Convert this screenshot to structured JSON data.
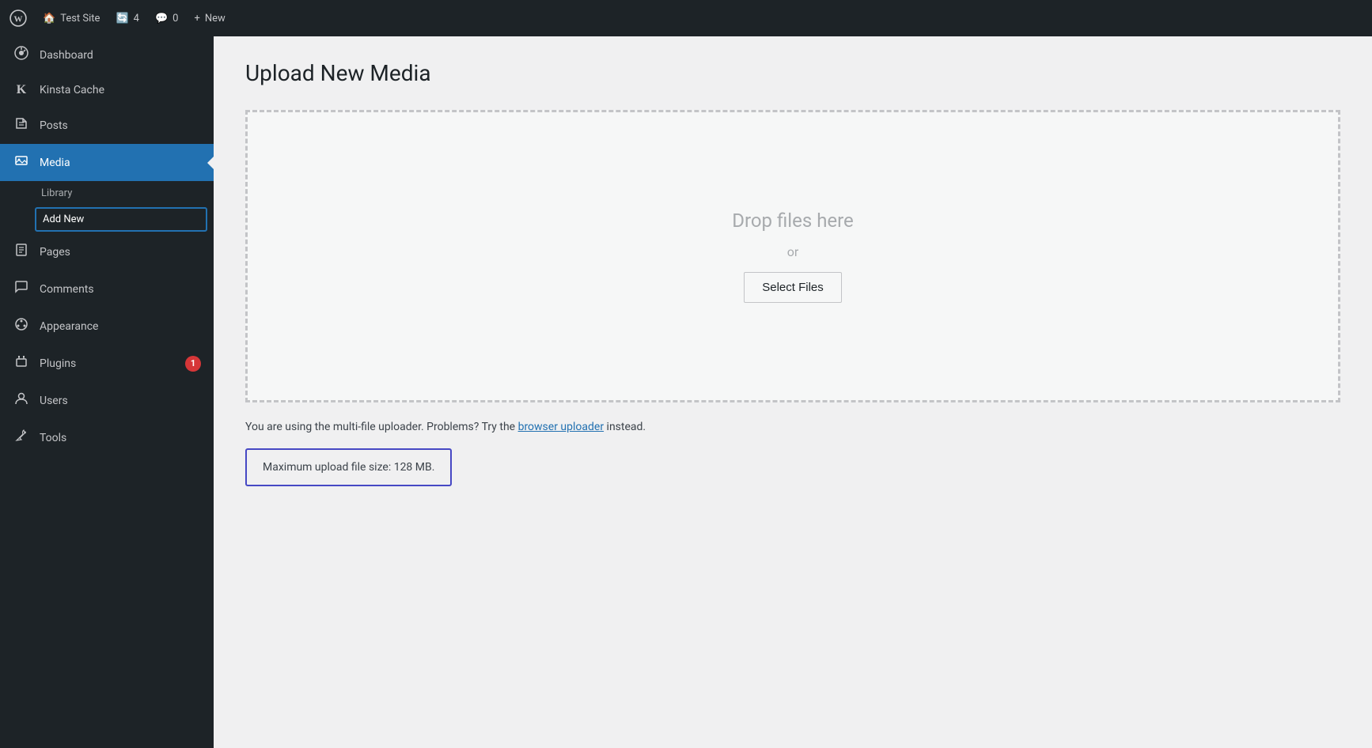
{
  "adminbar": {
    "wp_logo": "⚙",
    "site_name": "Test Site",
    "updates_count": "4",
    "comments_count": "0",
    "new_label": "New",
    "updates_icon": "🔄",
    "comments_icon": "💬",
    "plus_icon": "+"
  },
  "sidebar": {
    "items": [
      {
        "id": "dashboard",
        "label": "Dashboard",
        "icon": "🎨"
      },
      {
        "id": "kinsta-cache",
        "label": "Kinsta Cache",
        "icon": "K"
      },
      {
        "id": "posts",
        "label": "Posts",
        "icon": "📌"
      },
      {
        "id": "media",
        "label": "Media",
        "icon": "⚙",
        "active": true
      },
      {
        "id": "pages",
        "label": "Pages",
        "icon": "📄"
      },
      {
        "id": "comments",
        "label": "Comments",
        "icon": "💬"
      },
      {
        "id": "appearance",
        "label": "Appearance",
        "icon": "🖌"
      },
      {
        "id": "plugins",
        "label": "Plugins",
        "icon": "🔧",
        "badge": "1"
      },
      {
        "id": "users",
        "label": "Users",
        "icon": "👤"
      },
      {
        "id": "tools",
        "label": "Tools",
        "icon": "🔨"
      }
    ],
    "submenu": {
      "parent": "media",
      "items": [
        {
          "id": "library",
          "label": "Library"
        },
        {
          "id": "add-new",
          "label": "Add New",
          "active": true
        }
      ]
    }
  },
  "main": {
    "page_title": "Upload New Media",
    "upload_area": {
      "drop_text": "Drop files here",
      "or_text": "or",
      "select_files_label": "Select Files"
    },
    "info_text_before": "You are using the multi-file uploader. Problems? Try the ",
    "browser_uploader_link": "browser uploader",
    "info_text_after": " instead.",
    "max_size_label": "Maximum upload file size: 128 MB."
  }
}
